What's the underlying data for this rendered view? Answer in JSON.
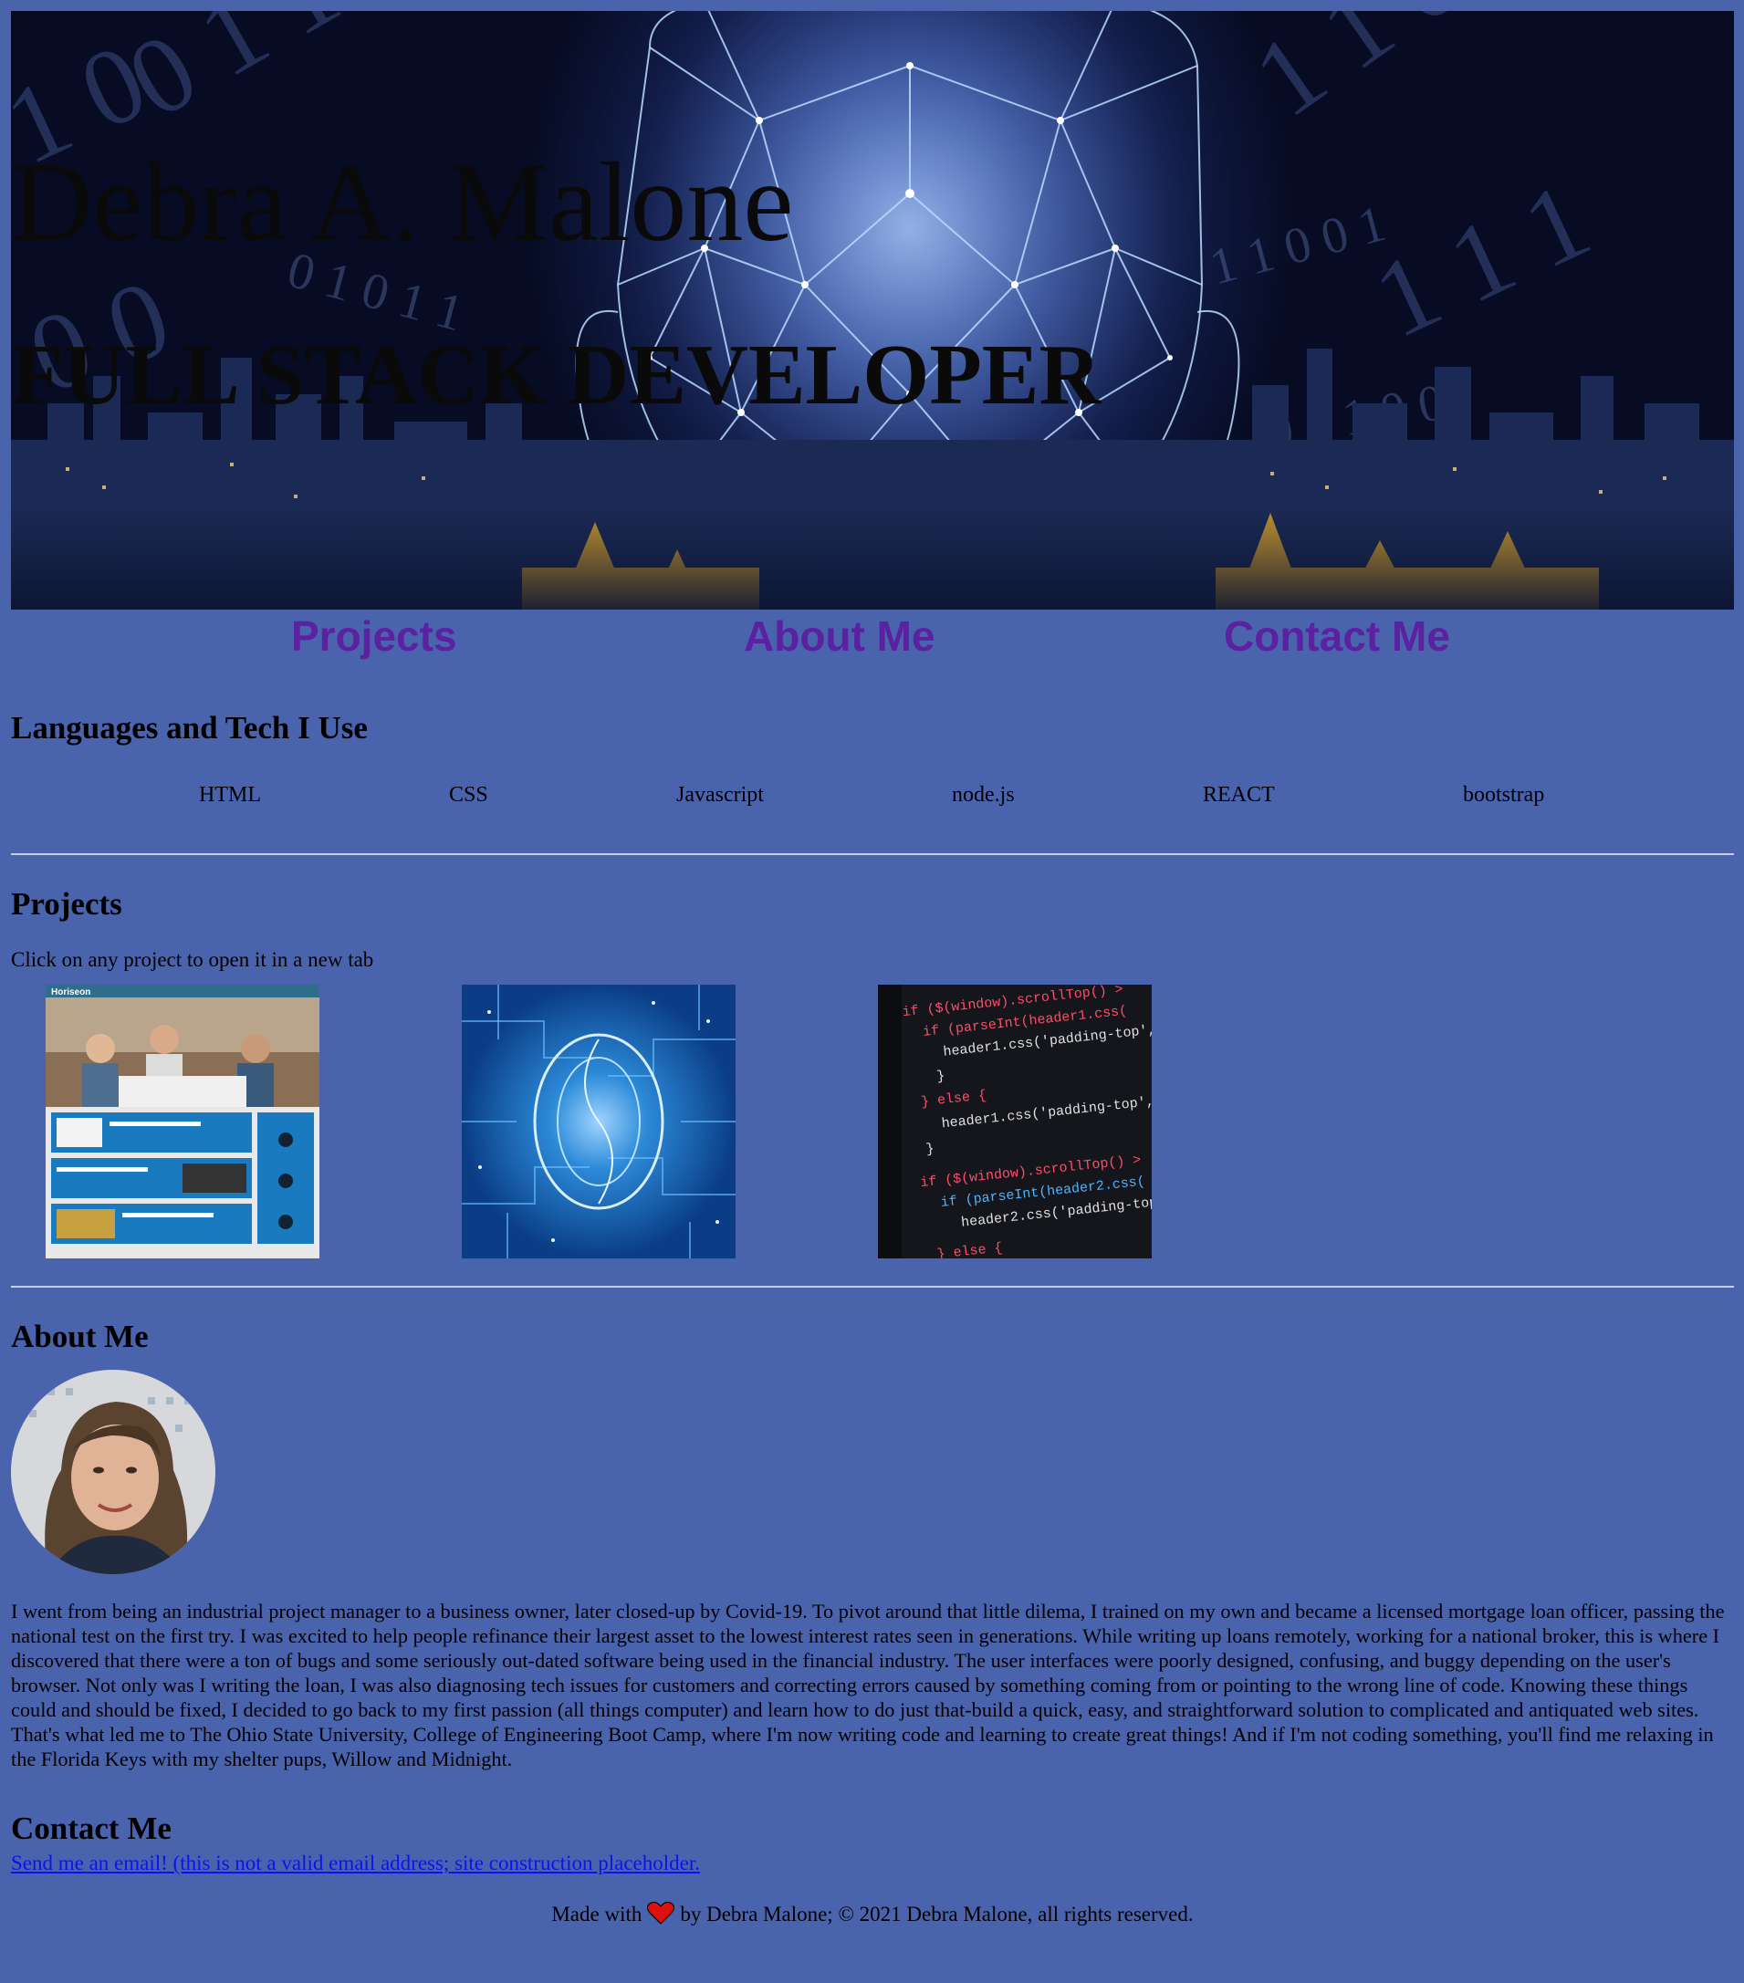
{
  "hero": {
    "name": "Debra A. Malone",
    "title": "FULL STACK DEVELOPER",
    "background_icon": "digital-head-city-icon"
  },
  "nav": {
    "projects": "Projects",
    "about": "About Me",
    "contact": "Contact Me",
    "link_color": "#5c21a1"
  },
  "tech_section": {
    "heading": "Languages and Tech I Use",
    "items": [
      "HTML",
      "CSS",
      "Javascript",
      "node.js",
      "REACT",
      "bootstrap"
    ]
  },
  "projects_section": {
    "heading": "Projects",
    "instruction": "Click on any project to open it in a new tab",
    "items": [
      {
        "thumbnail_icon": "horiseon-site-screenshot-icon"
      },
      {
        "thumbnail_icon": "circuit-brain-icon"
      },
      {
        "thumbnail_icon": "code-screen-icon"
      }
    ]
  },
  "about_section": {
    "heading": "About Me",
    "avatar_icon": "profile-photo-icon",
    "bio": "I went from being an industrial project manager to a business owner, later closed-up by Covid-19. To pivot around that little dilema, I trained on my own and became a licensed mortgage loan officer, passing the national test on the first try. I was excited to help people refinance their largest asset to the lowest interest rates seen in generations. While writing up loans remotely, working for a national broker, this is where I discovered that there were a ton of bugs and some seriously out-dated software being used in the financial industry. The user interfaces were poorly designed, confusing, and buggy depending on the user's browser. Not only was I writing the loan, I was also diagnosing tech issues for customers and correcting errors caused by something coming from or pointing to the wrong line of code. Knowing these things could and should be fixed, I decided to go back to my first passion (all things computer) and learn how to do just that-build a quick, easy, and straightforward solution to complicated and antiquated web sites. That's what led me to The Ohio State University, College of Engineering Boot Camp, where I'm now writing code and learning to create great things! And if I'm not coding something, you'll find me relaxing in the Florida Keys with my shelter pups, Willow and Midnight."
  },
  "contact_section": {
    "heading": "Contact Me",
    "email_link": "Send me an email! (this is not a valid email address; site construction placeholder."
  },
  "footer": {
    "made_with": "Made with",
    "heart_icon": "heart-icon",
    "credit": "by Debra Malone; © 2021 Debra Malone, all rights reserved."
  },
  "colors": {
    "page_background": "#4a63ad",
    "link": "#1010ee",
    "heart": "#e01010"
  }
}
